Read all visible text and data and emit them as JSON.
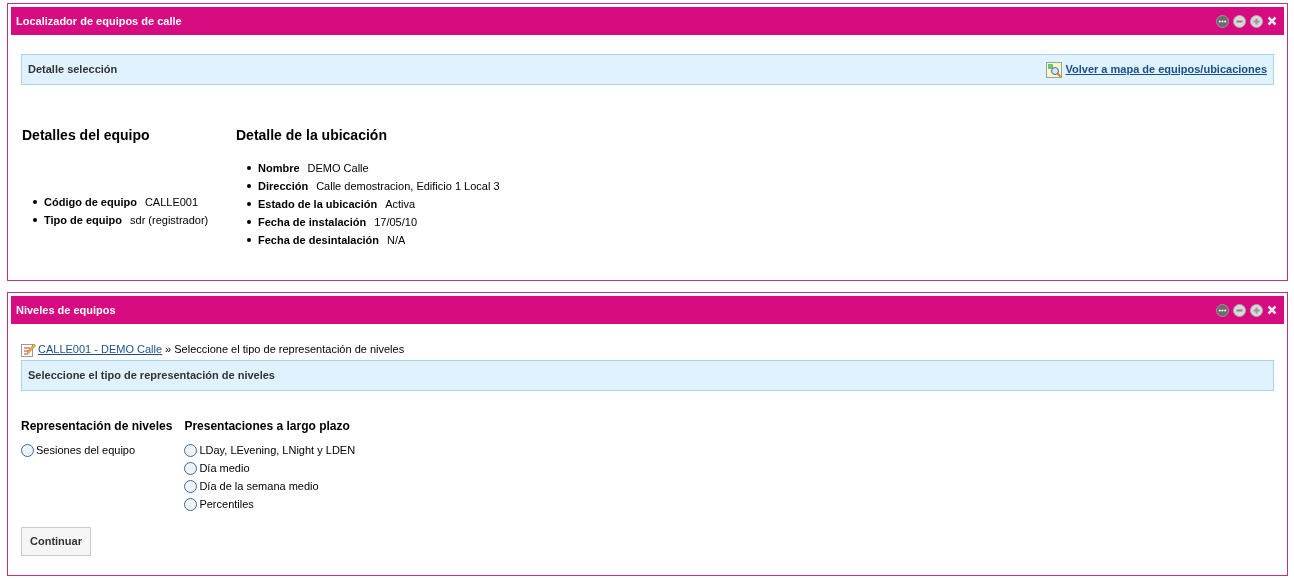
{
  "panels": [
    {
      "title": "Localizador de equipos de calle",
      "section_bar": {
        "title": "Detalle selección",
        "link": "Volver a mapa de equipos/ubicaciones"
      },
      "equipment": {
        "heading": "Detalles del equipo",
        "fields": [
          {
            "label": "Código de equipo",
            "value": "CALLE001"
          },
          {
            "label": "Tipo de equipo",
            "value": "sdr (registrador)"
          }
        ]
      },
      "location": {
        "heading": "Detalle de la ubicación",
        "fields": [
          {
            "label": "Nombre",
            "value": "DEMO Calle"
          },
          {
            "label": "Dirección",
            "value": "Calle demostracion, Edificio 1 Local 3"
          },
          {
            "label": "Estado de la ubicación",
            "value": "Activa"
          },
          {
            "label": "Fecha de instalación",
            "value": "17/05/10"
          },
          {
            "label": "Fecha de desintalación",
            "value": "N/A"
          }
        ]
      }
    },
    {
      "title": "Niveles de equipos",
      "breadcrumb": {
        "link": "CALLE001 - DEMO Calle",
        "separator": "»",
        "current": "Seleccione el tipo de representación de niveles"
      },
      "section_bar": {
        "title": "Seleccione el tipo de representación de niveles"
      },
      "groups": [
        {
          "heading": "Representación de niveles",
          "options": [
            {
              "label": "Sesiones del equipo",
              "selected": false
            }
          ]
        },
        {
          "heading": "Presentaciones a largo plazo",
          "options": [
            {
              "label": "LDay, LEvening, LNight y LDEN",
              "selected": false
            },
            {
              "label": "Día medio",
              "selected": false
            },
            {
              "label": "Día de la semana medio",
              "selected": false
            },
            {
              "label": "Percentiles",
              "selected": false
            }
          ]
        }
      ],
      "button": "Continuar"
    }
  ]
}
